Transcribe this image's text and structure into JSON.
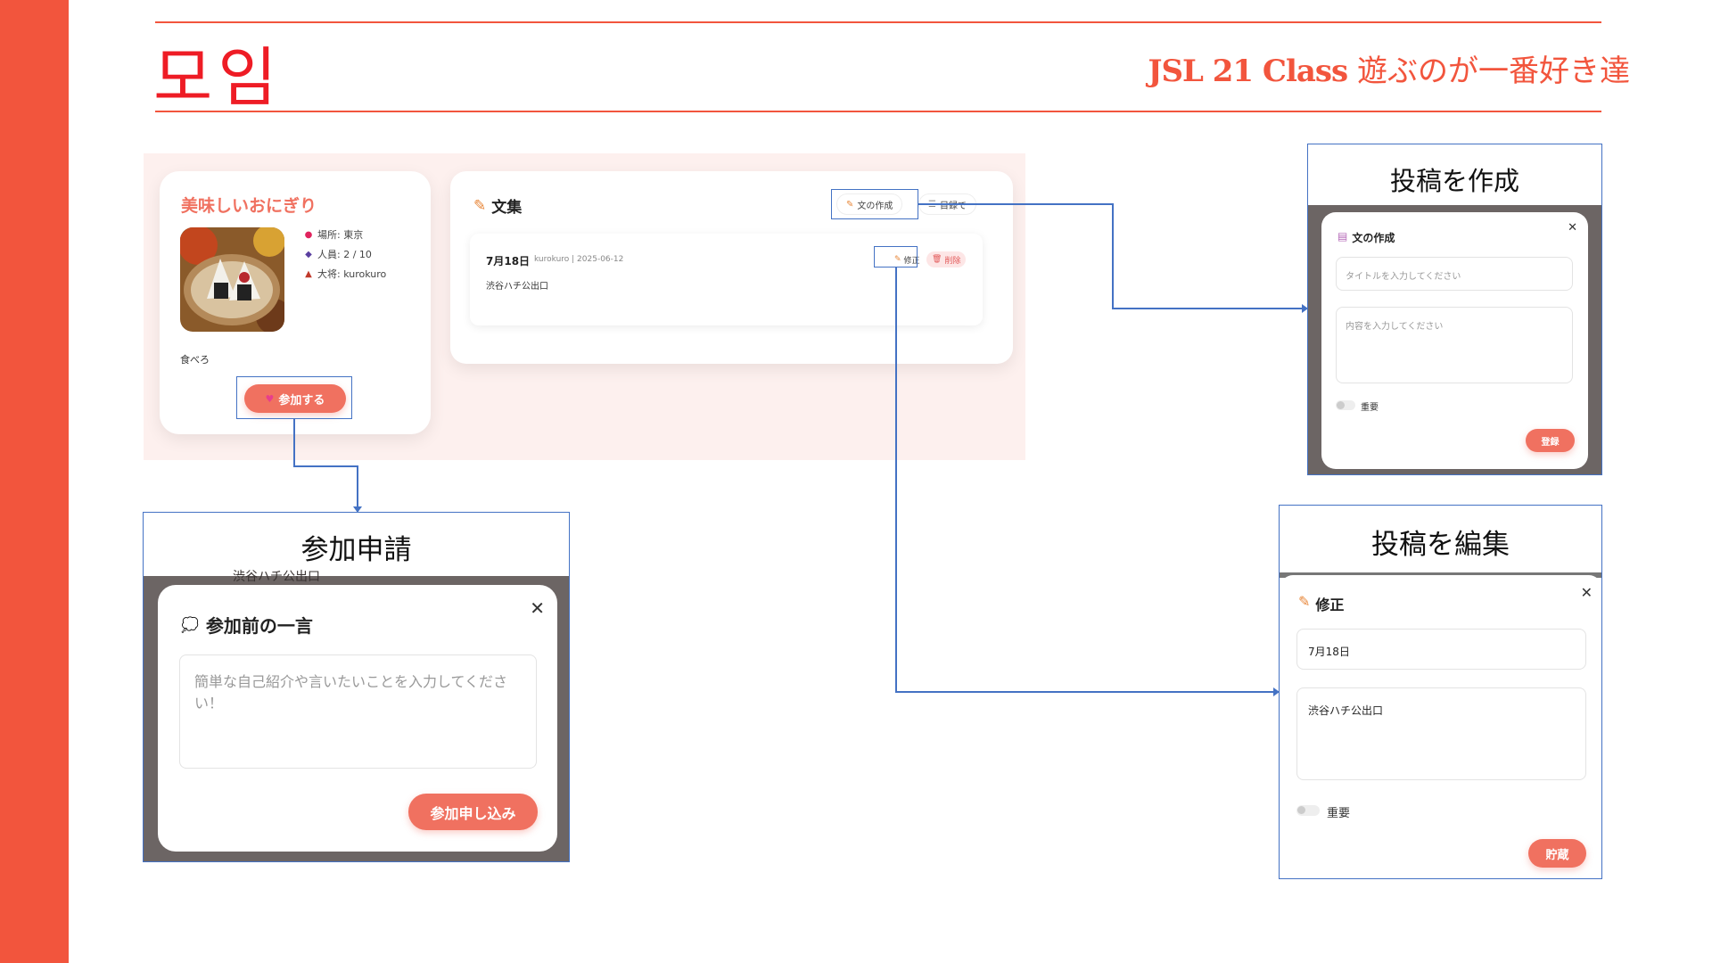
{
  "header": {
    "title": "모임",
    "subtitle_bold": "JSL 21 Class",
    "subtitle_rest": " 遊ぶのが一番好き達"
  },
  "gathering": {
    "title": "美味しいおにぎり",
    "location": "場所: 東京",
    "members": "人員: 2 / 10",
    "leader": "大将: kurokuro",
    "description": "食べろ",
    "join_label": "参加する"
  },
  "collection": {
    "title": "文集",
    "write_label": "文の作成",
    "list_label": "目録で",
    "post": {
      "date": "7月18日",
      "meta": "kurokuro | 2025-06-12",
      "body": "渋谷ハチ公出口",
      "edit_label": "修正",
      "delete_label": "削除"
    }
  },
  "dialog_join": {
    "caption": "参加申請",
    "heading": "参加前の一言",
    "placeholder": "簡単な自己紹介や言いたいことを入力してください！",
    "submit": "参加申し込み",
    "backdrop_text": "渋谷ハチ公出口"
  },
  "dialog_create": {
    "caption": "投稿を作成",
    "heading": "文の作成",
    "title_placeholder": "タイトルを入力してください",
    "content_placeholder": "内容を入力してください",
    "important_label": "重要",
    "submit": "登録"
  },
  "dialog_edit": {
    "caption": "投稿を編集",
    "heading": "修正",
    "title_value": "7月18日",
    "content_value": "渋谷ハチ公出口",
    "important_label": "重要",
    "submit": "貯蔵"
  },
  "colors": {
    "accent": "#f2553d",
    "title_red": "#ee1c25",
    "button": "#f07160",
    "connector": "#4472c4"
  }
}
